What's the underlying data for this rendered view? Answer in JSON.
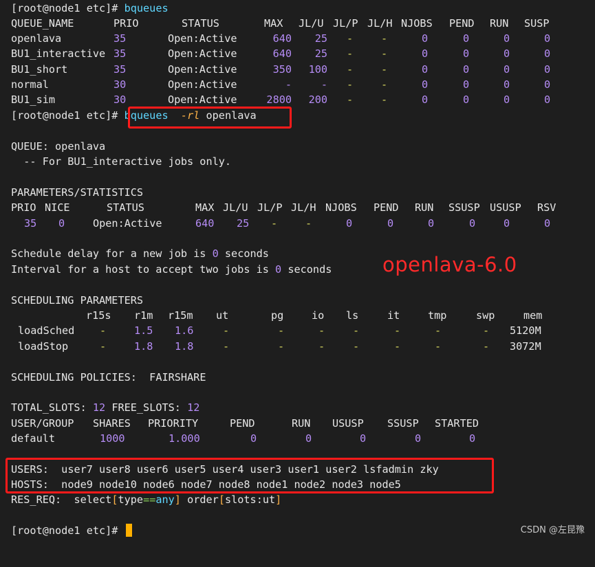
{
  "prompt": "[root@node1 etc]#",
  "cmd1": "bqueues",
  "cmd2": {
    "name": "bqueues",
    "flag": "-rl",
    "arg": "openlava"
  },
  "queue_table": {
    "headers": [
      "QUEUE_NAME",
      "PRIO",
      "STATUS",
      "MAX",
      "JL/U",
      "JL/P",
      "JL/H",
      "NJOBS",
      "PEND",
      "RUN",
      "SUSP"
    ],
    "rows": [
      [
        "openlava",
        "35",
        "Open:Active",
        "640",
        "25",
        "-",
        "-",
        "0",
        "0",
        "0",
        "0"
      ],
      [
        "BU1_interactive",
        "35",
        "Open:Active",
        "640",
        "25",
        "-",
        "-",
        "0",
        "0",
        "0",
        "0"
      ],
      [
        "BU1_short",
        "35",
        "Open:Active",
        "350",
        "100",
        "-",
        "-",
        "0",
        "0",
        "0",
        "0"
      ],
      [
        "normal",
        "30",
        "Open:Active",
        "-",
        "-",
        "-",
        "-",
        "0",
        "0",
        "0",
        "0"
      ],
      [
        "BU1_sim",
        "30",
        "Open:Active",
        "2800",
        "200",
        "-",
        "-",
        "0",
        "0",
        "0",
        "0"
      ]
    ]
  },
  "queue_detail": {
    "label": "QUEUE:",
    "name": "openlava",
    "desc": "  -- For BU1_interactive jobs only."
  },
  "params": {
    "title": "PARAMETERS/STATISTICS",
    "headers": [
      "PRIO",
      "NICE",
      "STATUS",
      "MAX",
      "JL/U",
      "JL/P",
      "JL/H",
      "NJOBS",
      "PEND",
      "RUN",
      "SSUSP",
      "USUSP",
      "RSV"
    ],
    "values": [
      "35",
      "0",
      "Open:Active",
      "640",
      "25",
      "-",
      "-",
      "0",
      "0",
      "0",
      "0",
      "0",
      "0"
    ]
  },
  "schedule": {
    "delay_pre": "Schedule delay for a new job is ",
    "delay_val": "0",
    "delay_post": " seconds",
    "interval_pre": "Interval for a host to accept two jobs is ",
    "interval_val": "0",
    "interval_post": " seconds"
  },
  "annotation": "openlava-6.0",
  "sched_params": {
    "title": "SCHEDULING PARAMETERS",
    "headers": [
      "r15s",
      "r1m",
      "r15m",
      "ut",
      "pg",
      "io",
      "ls",
      "it",
      "tmp",
      "swp",
      "mem"
    ],
    "rows": [
      {
        "label": "loadSched",
        "values": [
          "-",
          "1.5",
          "1.6",
          "-",
          "-",
          "-",
          "-",
          "-",
          "-",
          "-",
          "5120M"
        ]
      },
      {
        "label": "loadStop",
        "values": [
          "-",
          "1.8",
          "1.8",
          "-",
          "-",
          "-",
          "-",
          "-",
          "-",
          "-",
          "3072M"
        ]
      }
    ]
  },
  "policies": {
    "label": "SCHEDULING POLICIES:",
    "value": "FAIRSHARE"
  },
  "slots": {
    "total_label": "TOTAL_SLOTS:",
    "total": "12",
    "free_label": "FREE_SLOTS:",
    "free": "12"
  },
  "fairshare": {
    "headers": [
      "USER/GROUP",
      "SHARES",
      "PRIORITY",
      "PEND",
      "RUN",
      "USUSP",
      "SSUSP",
      "STARTED"
    ],
    "row": [
      "default",
      "1000",
      "1.000",
      "0",
      "0",
      "0",
      "0",
      "0"
    ]
  },
  "users": {
    "label": "USERS:",
    "value": "user7 user8 user6 user5 user4 user3 user1 user2 lsfadmin zky"
  },
  "hosts": {
    "label": "HOSTS:",
    "value": "node9 node10 node6 node7 node8 node1 node2 node3 node5"
  },
  "res_req": {
    "label": "RES_REQ:",
    "select": "select",
    "b1": "[",
    "type": "type",
    "eq": "==",
    "any": "any",
    "b2": "]",
    "order": " order",
    "b3": "[",
    "slots": "slots:ut",
    "b4": "]"
  },
  "watermark": "CSDN @左昆豫",
  "colors": {
    "background": "#1e1e1e",
    "highlight_box": "#ff1a1a",
    "number": "#b58cf5",
    "cursor": "#ffb000"
  }
}
